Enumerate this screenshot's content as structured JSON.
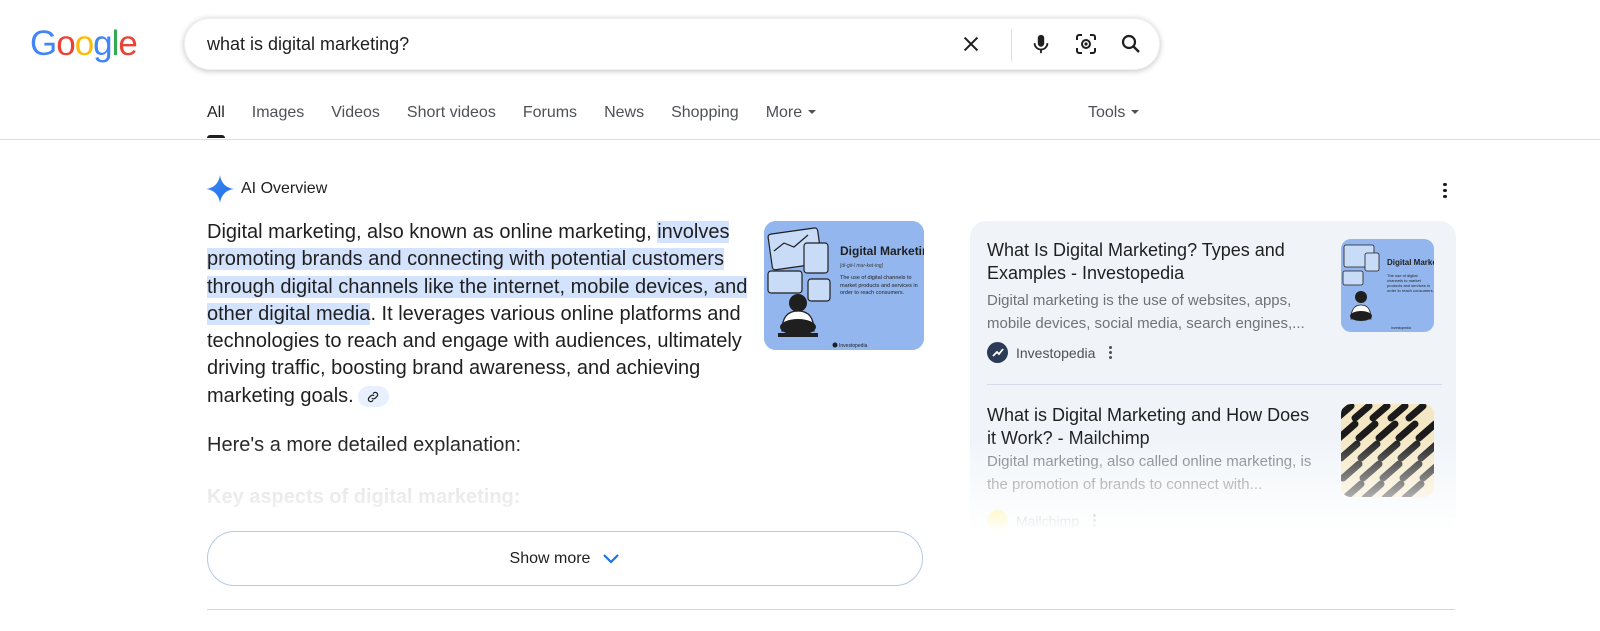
{
  "logo": {
    "letters": [
      "G",
      "o",
      "o",
      "g",
      "l",
      "e"
    ],
    "colors": [
      "#4285f4",
      "#ea4335",
      "#fbbc05",
      "#4285f4",
      "#34a853",
      "#ea4335"
    ]
  },
  "search": {
    "value": "what is digital marketing?",
    "icons": [
      "close-icon",
      "mic-icon",
      "lens-icon",
      "search-icon"
    ]
  },
  "tabs": [
    "All",
    "Images",
    "Videos",
    "Short videos",
    "Forums",
    "News",
    "Shopping",
    "More"
  ],
  "tools_label": "Tools",
  "ai_overview": {
    "title": "AI Overview",
    "text_plain_1": "Digital marketing, also known as online marketing, ",
    "text_highlight": "involves promoting brands and connecting with potential customers through digital channels like the internet, mobile devices, and other digital media",
    "text_plain_2": ". It leverages various online platforms and technologies to reach and engage with audiences, ultimately driving traffic, boosting brand awareness, and achieving marketing goals.",
    "explanation": "Here's a more detailed explanation:",
    "subheading": "Key aspects of digital marketing:",
    "show_more": "Show more",
    "image": {
      "title": "Digital Marketing",
      "pronunciation": "[di-git-l mar-ket-ing]",
      "description": "The use of digital channels to market products and services in order to reach consumers.",
      "credit": "Investopedia"
    }
  },
  "sources": [
    {
      "title": "What Is Digital Marketing? Types and Examples - Investopedia",
      "snippet": "Digital marketing is the use of websites, apps, mobile devices, social media, search engines,...",
      "site": "Investopedia"
    },
    {
      "title": "What is Digital Marketing and How Does it Work? - Mailchimp",
      "snippet": "Digital marketing, also called online marketing, is the promotion of brands to connect with...",
      "site": "Mailchimp"
    }
  ],
  "colors": {
    "accent": "#1a73e8",
    "highlight": "#d3e3fd",
    "card_bg": "#f0f4f9",
    "image_bg": "#93b6ee"
  }
}
